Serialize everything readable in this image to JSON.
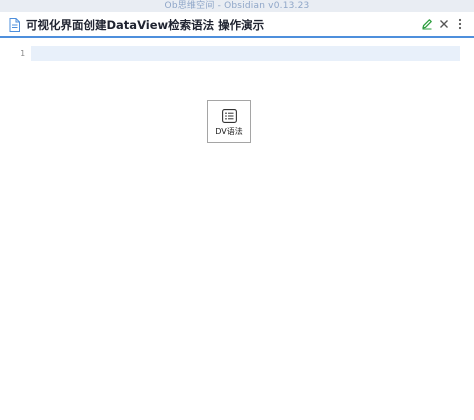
{
  "window": {
    "title": "Ob思维空间 - Obsidian v0.13.23"
  },
  "note": {
    "title": "可视化界面创建DataView检索语法 操作演示"
  },
  "editor": {
    "line_number": "1"
  },
  "dv_button": {
    "label": "DV语法",
    "icon": "list-icon"
  },
  "colors": {
    "accent": "#4e8fdc",
    "edit_icon": "#2e9e3f",
    "active_line": "#e8f0fa"
  }
}
